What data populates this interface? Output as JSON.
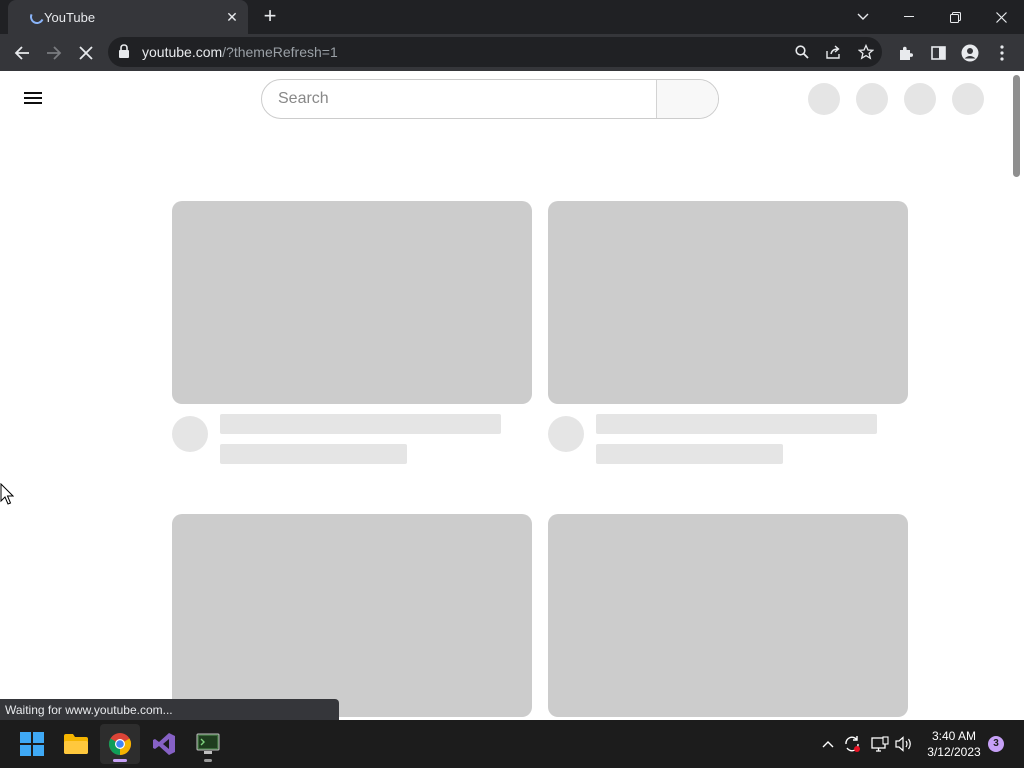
{
  "browser": {
    "tab": {
      "title": "YouTube",
      "close_glyph": "✕",
      "status": "loading"
    },
    "new_tab_glyph": "+",
    "window_controls": [
      "chevron-down-icon",
      "minimize-icon",
      "restore-icon",
      "close-icon"
    ],
    "toolbar": {
      "url_host": "youtube.com",
      "url_path": "/?themeRefresh=1",
      "icons": [
        "back-arrow-icon",
        "forward-arrow-icon",
        "stop-loading-icon",
        "lock-icon",
        "search-icon",
        "share-icon",
        "bookmark-star-icon",
        "extensions-icon",
        "side-panel-icon",
        "profile-icon",
        "menu-dots-icon"
      ]
    },
    "status_bubble": "Waiting for www.youtube.com..."
  },
  "page": {
    "search": {
      "placeholder": "Search",
      "value": ""
    },
    "header_placeholders": 4,
    "skeleton_cards": 4
  },
  "taskbar": {
    "apps": [
      "windows-start-icon",
      "file-explorer-icon",
      "chrome-icon",
      "visual-studio-icon",
      "terminal-app-icon"
    ],
    "tray_icons": [
      "chevron-up-icon",
      "sync-icon",
      "display-icon",
      "volume-icon"
    ],
    "clock": {
      "time": "3:40 AM",
      "date": "3/12/2023"
    },
    "notifications": "3"
  },
  "colors": {
    "chrome_dark": "#202124",
    "chrome_toolbar": "#35363a",
    "skeleton_thumb": "#cccccc",
    "skeleton_light": "#e5e5e5",
    "taskbar": "#1c1c1c",
    "accent": "#c6a0f6"
  }
}
